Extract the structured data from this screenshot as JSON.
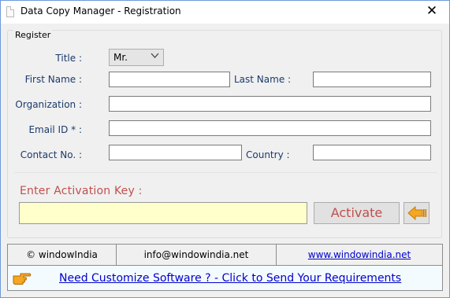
{
  "window": {
    "title": "Data Copy Manager - Registration",
    "close_glyph": "✕"
  },
  "register": {
    "group_label": "Register",
    "title_label": "Title :",
    "title_value": "Mr.",
    "first_name_label": "First Name :",
    "last_name_label": "Last Name :",
    "organization_label": "Organization :",
    "email_label": "Email ID * :",
    "contact_label": "Contact No. :",
    "country_label": "Country :",
    "first_name_value": "",
    "last_name_value": "",
    "organization_value": "",
    "email_value": "",
    "contact_value": "",
    "country_value": ""
  },
  "activation": {
    "label": "Enter Activation Key  :",
    "key_value": "",
    "activate_label": "Activate",
    "back_icon": "arrow-left-icon"
  },
  "footer": {
    "copyright": "© windowIndia",
    "email": "info@windowindia.net",
    "website": "www.windowindia.net"
  },
  "banner": {
    "link_text": "Need Customize Software ? - Click to Send Your Requirements",
    "icon": "pointing-hand-icon"
  },
  "colors": {
    "label_blue": "#1b3a6b",
    "accent_red": "#c0504d",
    "link_blue": "#0000cc",
    "key_field_bg": "#ffffcc",
    "arrow_orange": "#f5a623"
  }
}
